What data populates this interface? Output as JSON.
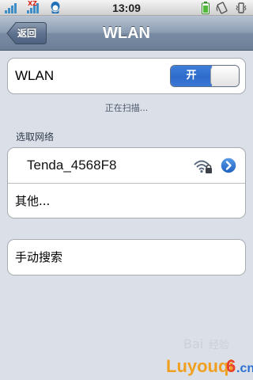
{
  "status_bar": {
    "carrier_text": "XZ",
    "time": "13:09"
  },
  "nav": {
    "back_label": "返回",
    "title": "WLAN"
  },
  "wlan": {
    "label": "WLAN",
    "switch_on_label": "开"
  },
  "scanning_text": "正在扫描...",
  "networks_section": {
    "header": "选取网络",
    "items": [
      {
        "name": "Tenda_4568F8",
        "secured": true
      }
    ],
    "other_label": "其他..."
  },
  "manual_search_label": "手动搜索",
  "watermark_text": "Luyouqi6.cn",
  "colors": {
    "switch_blue": "#2f6bcb",
    "nav_bar": "#7a8ca4",
    "background": "#dbe0e8",
    "detail_blue": "#2d75d6"
  }
}
